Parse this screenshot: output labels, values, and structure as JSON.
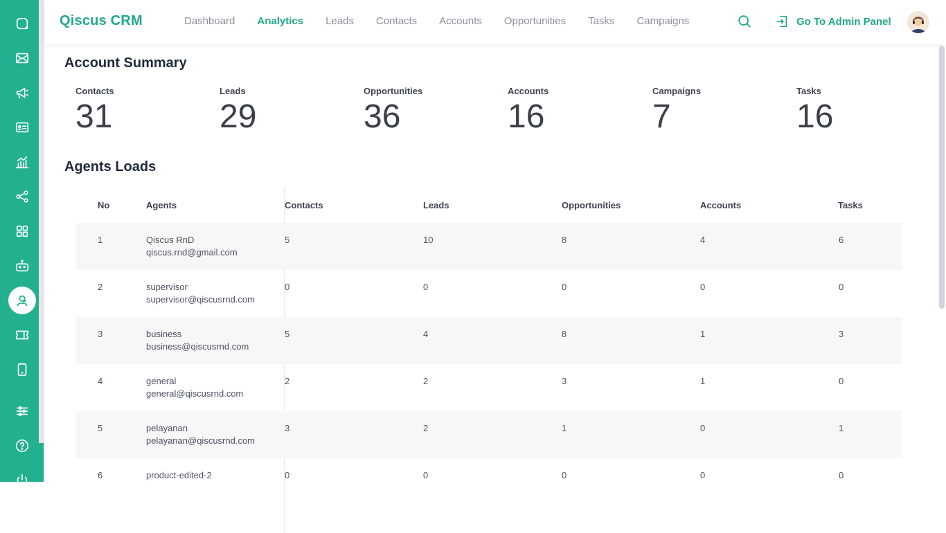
{
  "sidebar": {
    "icons": [
      "chat-icon",
      "mail-icon",
      "megaphone-icon",
      "contact-card-icon",
      "analytics-chart-icon",
      "share-nodes-icon",
      "apps-grid-icon",
      "robot-icon",
      "agent-icon",
      "ticket-icon",
      "tablet-icon",
      "sliders-icon",
      "help-icon",
      "power-icon"
    ],
    "active": "agent-icon"
  },
  "header": {
    "brand": "Qiscus CRM",
    "nav": [
      "Dashboard",
      "Analytics",
      "Leads",
      "Contacts",
      "Accounts",
      "Opportunities",
      "Tasks",
      "Campaigns"
    ],
    "active_nav": "Analytics",
    "admin_label": "Go To Admin Panel"
  },
  "summary": {
    "title": "Account Summary",
    "stats": [
      {
        "label": "Contacts",
        "value": "31"
      },
      {
        "label": "Leads",
        "value": "29"
      },
      {
        "label": "Opportunities",
        "value": "36"
      },
      {
        "label": "Accounts",
        "value": "16"
      },
      {
        "label": "Campaigns",
        "value": "7"
      },
      {
        "label": "Tasks",
        "value": "16"
      }
    ]
  },
  "agents": {
    "title": "Agents Loads",
    "columns": [
      "No",
      "Agents",
      "Contacts",
      "Leads",
      "Opportunities",
      "Accounts",
      "Tasks"
    ],
    "rows": [
      {
        "no": "1",
        "name": "Qiscus RnD",
        "email": "qiscus.rnd@gmail.com",
        "contacts": "5",
        "leads": "10",
        "opportunities": "8",
        "accounts": "4",
        "tasks": "6"
      },
      {
        "no": "2",
        "name": "supervisor",
        "email": "supervisor@qiscusrnd.com",
        "contacts": "0",
        "leads": "0",
        "opportunities": "0",
        "accounts": "0",
        "tasks": "0"
      },
      {
        "no": "3",
        "name": "business",
        "email": "business@qiscusrnd.com",
        "contacts": "5",
        "leads": "4",
        "opportunities": "8",
        "accounts": "1",
        "tasks": "3"
      },
      {
        "no": "4",
        "name": "general",
        "email": "general@qiscusrnd.com",
        "contacts": "2",
        "leads": "2",
        "opportunities": "3",
        "accounts": "1",
        "tasks": "0"
      },
      {
        "no": "5",
        "name": "pelayanan",
        "email": "pelayanan@qiscusrnd.com",
        "contacts": "3",
        "leads": "2",
        "opportunities": "1",
        "accounts": "0",
        "tasks": "1"
      },
      {
        "no": "6",
        "name": "product-edited-2",
        "email": "",
        "contacts": "0",
        "leads": "0",
        "opportunities": "0",
        "accounts": "0",
        "tasks": "0"
      }
    ]
  },
  "colors": {
    "accent": "#22b08f",
    "text": "#1f2937"
  }
}
